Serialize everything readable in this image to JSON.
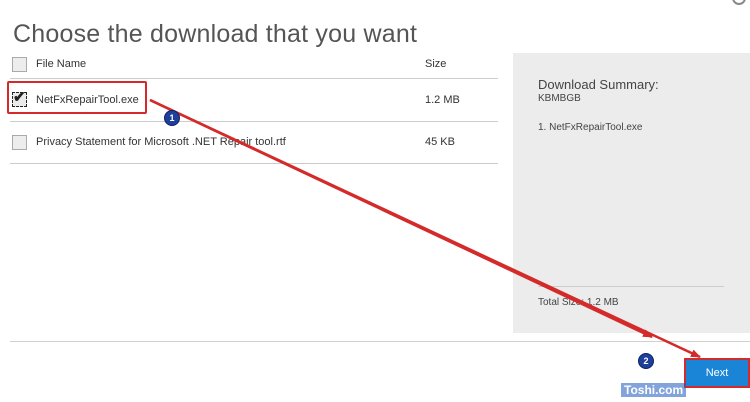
{
  "page": {
    "title": "Choose the download that you want"
  },
  "table": {
    "header": {
      "file_name": "File Name",
      "size": "Size"
    },
    "rows": [
      {
        "name": "NetFxRepairTool.exe",
        "size": "1.2 MB",
        "checked": true
      },
      {
        "name": "Privacy Statement for Microsoft .NET Repair tool.rtf",
        "size": "45 KB",
        "checked": false
      }
    ]
  },
  "summary": {
    "title": "Download Summary:",
    "subtitle": "KBMBGB",
    "items": [
      "1. NetFxRepairTool.exe"
    ],
    "total": "Total Size: 1.2 MB"
  },
  "buttons": {
    "next": "Next"
  },
  "annotations": {
    "badge1": "1",
    "badge2": "2",
    "watermark": "Toshi.com"
  },
  "colors": {
    "accent": "#1a85d6",
    "annotation_red": "#d42a2a",
    "badge_blue": "#1e3f9a",
    "summary_bg": "#ececec"
  },
  "icons": {
    "checkbox_checked": "check-mark-icon",
    "settings_corner": "partial-circle-icon"
  }
}
